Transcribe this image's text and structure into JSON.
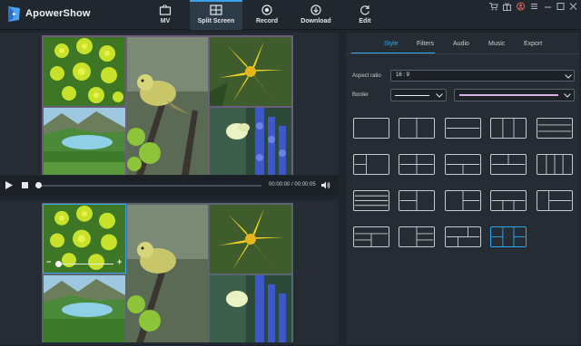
{
  "app": {
    "title": "ApowerShow",
    "accent_color": "#3aa0e8"
  },
  "nav": {
    "items": [
      {
        "label": "MV",
        "icon": "mv-icon",
        "active": false
      },
      {
        "label": "Split Screen",
        "icon": "split-screen-icon",
        "active": true
      },
      {
        "label": "Record",
        "icon": "record-icon",
        "active": false
      },
      {
        "label": "Download",
        "icon": "download-icon",
        "active": false
      },
      {
        "label": "Edit",
        "icon": "edit-icon",
        "active": false
      }
    ]
  },
  "window_controls": [
    "cart-icon",
    "gift-icon",
    "user-icon",
    "menu-icon",
    "minimize-icon",
    "maximize-icon",
    "close-icon"
  ],
  "player": {
    "timecode": "00:00:00 / 00:00:05",
    "progress": 0
  },
  "tabs": [
    {
      "label": "Style",
      "active": true
    },
    {
      "label": "Filters",
      "active": false
    },
    {
      "label": "Audio",
      "active": false
    },
    {
      "label": "Music",
      "active": false
    },
    {
      "label": "Export",
      "active": false
    }
  ],
  "style_panel": {
    "aspect_ratio_label": "Aspect ratio",
    "aspect_ratio_value": "16 : 9",
    "border_label": "Border",
    "border_color": "#d9b0e6"
  },
  "zoom": {
    "minus": "−",
    "plus": "+"
  },
  "layouts": {
    "count": 19,
    "selected_index": 18
  }
}
